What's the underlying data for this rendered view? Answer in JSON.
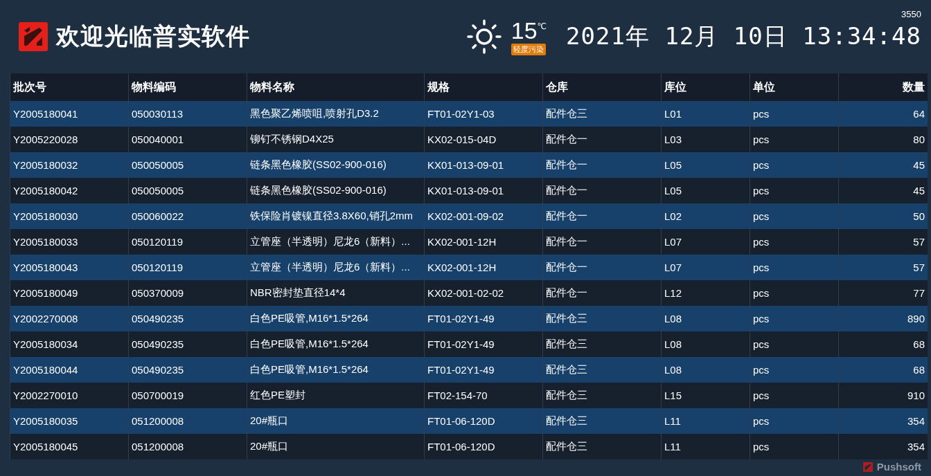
{
  "header": {
    "title": "欢迎光临普实软件",
    "weather": {
      "temperature": "15",
      "unit": "℃",
      "air_quality": "轻度污染"
    },
    "datetime": "2021年 12月 10日 13:34:48",
    "counter": "3550"
  },
  "table": {
    "columns": [
      "批次号",
      "物料编码",
      "物料名称",
      "规格",
      "仓库",
      "库位",
      "单位",
      "数量"
    ],
    "rows": [
      [
        "Y2005180041",
        "050030113",
        "黑色聚乙烯喷咀,喷射孔D3.2",
        "FT01-02Y1-03",
        "配件仓三",
        "L01",
        "pcs",
        "64"
      ],
      [
        "Y2005220028",
        "050040001",
        "铆钉不锈钢D4X25",
        "KX02-015-04D",
        "配件仓一",
        "L03",
        "pcs",
        "80"
      ],
      [
        "Y2005180032",
        "050050005",
        "链条黑色橡胶(SS02-900-016)",
        "KX01-013-09-01",
        "配件仓一",
        "L05",
        "pcs",
        "45"
      ],
      [
        "Y2005180042",
        "050050005",
        "链条黑色橡胶(SS02-900-016)",
        "KX01-013-09-01",
        "配件仓一",
        "L05",
        "pcs",
        "45"
      ],
      [
        "Y2005180030",
        "050060022",
        "铁保险肖镀镍直径3.8X60,销孔2mm",
        "KX02-001-09-02",
        "配件仓一",
        "L02",
        "pcs",
        "50"
      ],
      [
        "Y2005180033",
        "050120119",
        "立管座（半透明）尼龙6（新料）...",
        "KX02-001-12H",
        "配件仓一",
        "L07",
        "pcs",
        "57"
      ],
      [
        "Y2005180043",
        "050120119",
        "立管座（半透明）尼龙6（新料）...",
        "KX02-001-12H",
        "配件仓一",
        "L07",
        "pcs",
        "57"
      ],
      [
        "Y2005180049",
        "050370009",
        "NBR密封垫直径14*4",
        "KX02-001-02-02",
        "配件仓一",
        "L12",
        "pcs",
        "77"
      ],
      [
        "Y2002270008",
        "050490235",
        "白色PE吸管,M16*1.5*264",
        "FT01-02Y1-49",
        "配件仓三",
        "L08",
        "pcs",
        "890"
      ],
      [
        "Y2005180034",
        "050490235",
        "白色PE吸管,M16*1.5*264",
        "FT01-02Y1-49",
        "配件仓三",
        "L08",
        "pcs",
        "68"
      ],
      [
        "Y2005180044",
        "050490235",
        "白色PE吸管,M16*1.5*264",
        "FT01-02Y1-49",
        "配件仓三",
        "L08",
        "pcs",
        "68"
      ],
      [
        "Y2002270010",
        "050700019",
        "红色PE塑封",
        "FT02-154-70",
        "配件仓三",
        "L15",
        "pcs",
        "910"
      ],
      [
        "Y2005180035",
        "051200008",
        "20#瓶口",
        "FT01-06-120D",
        "配件仓三",
        "L11",
        "pcs",
        "354"
      ],
      [
        "Y2005180045",
        "051200008",
        "20#瓶口",
        "FT01-06-120D",
        "配件仓三",
        "L11",
        "pcs",
        "354"
      ]
    ]
  },
  "footer": {
    "brand": "Pushsoft"
  }
}
